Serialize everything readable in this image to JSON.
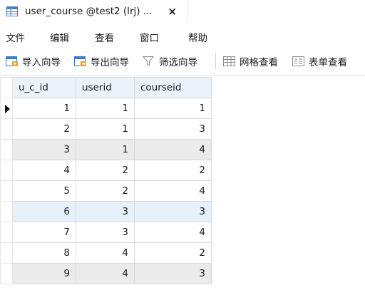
{
  "tab": {
    "title": "user_course @test2 (lrj) ...",
    "close": "×"
  },
  "menu": [
    "文件",
    "编辑",
    "查看",
    "窗口",
    "帮助"
  ],
  "toolbar": {
    "import_wizard": "导入向导",
    "export_wizard": "导出向导",
    "filter_wizard": "筛选向导",
    "grid_view": "网格查看",
    "form_view": "表单查看"
  },
  "table": {
    "columns": [
      "u_c_id",
      "userid",
      "courseid"
    ],
    "rows": [
      [
        "1",
        "1",
        "1"
      ],
      [
        "2",
        "1",
        "3"
      ],
      [
        "3",
        "1",
        "4"
      ],
      [
        "4",
        "2",
        "2"
      ],
      [
        "5",
        "2",
        "4"
      ],
      [
        "6",
        "3",
        "3"
      ],
      [
        "7",
        "3",
        "4"
      ],
      [
        "8",
        "4",
        "2"
      ],
      [
        "9",
        "4",
        "3"
      ]
    ],
    "current_row": 0
  },
  "colors": {
    "header_bg": "#eaf2fb",
    "alt_row": "#ebebeb",
    "selected_row": "#e5f0fb"
  }
}
